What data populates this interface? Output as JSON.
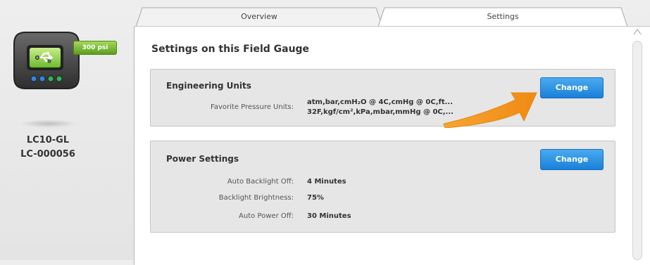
{
  "device": {
    "badge": "300 psi",
    "model": "LC10-GL",
    "serial": "LC-000056",
    "icon": "usb-icon",
    "led_colors": [
      "#2e8ae0",
      "#2e8ae0",
      "#36b060",
      "#36b060"
    ]
  },
  "tabs": [
    {
      "label": "Overview"
    },
    {
      "label": "Settings"
    }
  ],
  "page_title": "Settings on this Field Gauge",
  "engineering_units": {
    "title": "Engineering Units",
    "favorite_label": "Favorite Pressure Units:",
    "favorite_line1": "atm,bar,cmH₂O @ 4C,cmHg @ 0C,ft...",
    "favorite_line2": "32F,kgf/cm²,kPa,mbar,mmHg @ 0C,...",
    "change_label": "Change"
  },
  "power_settings": {
    "title": "Power Settings",
    "rows": [
      {
        "label": "Auto Backlight Off:",
        "value": "4 Minutes"
      },
      {
        "label": "Backlight Brightness:",
        "value": "75%"
      },
      {
        "label": "Auto Power Off:",
        "value": "30 Minutes"
      }
    ],
    "change_label": "Change"
  },
  "colors": {
    "accent_button": "#2a8fe6",
    "badge_green": "#7cc243",
    "callout_arrow": "#f39a1e"
  }
}
